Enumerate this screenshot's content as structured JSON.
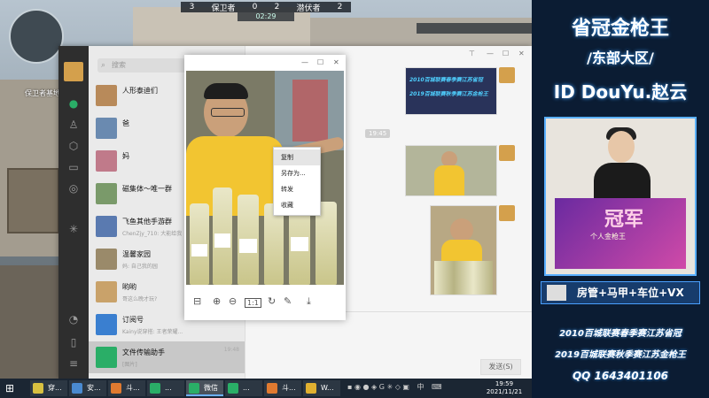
{
  "game": {
    "team_left": "保卫者",
    "team_left_count": "3",
    "score_left": "0",
    "score_right": "2",
    "team_right": "潜伏者",
    "team_right_count": "2",
    "timer": "02:29",
    "map_label": "保卫者基地"
  },
  "wechat": {
    "search_placeholder": "搜索",
    "chats": [
      {
        "name": "人形泰迪们",
        "preview": "",
        "time": "",
        "color": "#b88a5a"
      },
      {
        "name": "爸",
        "preview": "",
        "time": "",
        "color": "#6a8ab0"
      },
      {
        "name": "妈",
        "preview": "",
        "time": "",
        "color": "#c07a8a"
      },
      {
        "name": "磁集体～唯一群",
        "preview": "",
        "time": "",
        "color": "#7a9a6a"
      },
      {
        "name": "飞鱼其他手游群",
        "preview": "ChenZjy_710: 大能给我",
        "time": "",
        "color": "#5a7ab0"
      },
      {
        "name": "温馨家园",
        "preview": "妈: 自己我的园",
        "time": "",
        "color": "#9a8a6a"
      },
      {
        "name": "哟哟",
        "preview": "哥这么晚才玩?",
        "time": "",
        "color": "#c9a26a"
      },
      {
        "name": "订阅号",
        "preview": "Kainy说穿搭: 王者荣耀...",
        "time": "",
        "color": "#3a7fd0"
      },
      {
        "name": "文件传输助手",
        "preview": "[图片]",
        "time": "19:48",
        "color": "#2aae67"
      }
    ],
    "timestamp": "19:45",
    "send_label": "发送(S)",
    "context_menu": [
      "复制",
      "另存为...",
      "转发",
      "收藏"
    ],
    "rail_icons": [
      "chat-icon",
      "contacts-icon",
      "box-icon",
      "folder-icon",
      "moments-icon",
      "mini-program-icon",
      "phone-icon",
      "menu-icon"
    ]
  },
  "overlay": {
    "title1": "省冠金枪王",
    "title2": "/东部大区/",
    "title3": "ID DouYu.赵云",
    "banner_text": "冠军",
    "banner_sub": "个人金枪王",
    "tag": "房管+马甲+车位+VX",
    "line1": "2010百城联赛春季赛江苏省冠",
    "line2": "2019百城联赛秋季赛江苏金枪王",
    "line3": "QQ 1643401106"
  },
  "taskbar": {
    "apps": [
      {
        "label": "穿...",
        "color": "#d8c040"
      },
      {
        "label": "安...",
        "color": "#4a8ad0"
      },
      {
        "label": "斗...",
        "color": "#e07a30"
      },
      {
        "label": "...",
        "color": "#2aae67"
      },
      {
        "label": "微信",
        "color": "#2aae67"
      },
      {
        "label": "...",
        "color": "#2aae67"
      },
      {
        "label": "斗...",
        "color": "#e07a30"
      },
      {
        "label": "W...",
        "color": "#e0b030"
      }
    ],
    "tray_lang": "中",
    "clock_time": "19:59",
    "clock_date": "2021/11/21"
  }
}
